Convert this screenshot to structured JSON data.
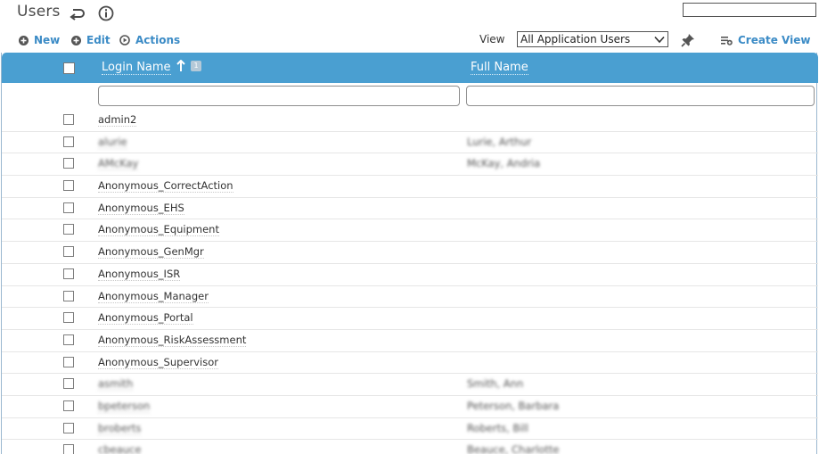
{
  "page": {
    "title": "Users"
  },
  "search": {
    "value": "",
    "placeholder": ""
  },
  "toolbar": {
    "new_label": "New",
    "edit_label": "Edit",
    "actions_label": "Actions",
    "view_label": "View",
    "view_selected": "All Application Users",
    "create_view_label": "Create View"
  },
  "grid": {
    "columns": {
      "login_name": "Login Name",
      "full_name": "Full Name"
    },
    "sort_order_badge": "1",
    "rows": [
      {
        "login": "admin2",
        "full_name": ""
      },
      {
        "login": "alurie",
        "full_name": "Lurie, Arthur"
      },
      {
        "login": "AMcKay",
        "full_name": "McKay, Andria"
      },
      {
        "login": "Anonymous_CorrectAction",
        "full_name": ""
      },
      {
        "login": "Anonymous_EHS",
        "full_name": ""
      },
      {
        "login": "Anonymous_Equipment",
        "full_name": ""
      },
      {
        "login": "Anonymous_GenMgr",
        "full_name": ""
      },
      {
        "login": "Anonymous_ISR",
        "full_name": ""
      },
      {
        "login": "Anonymous_Manager",
        "full_name": ""
      },
      {
        "login": "Anonymous_Portal",
        "full_name": ""
      },
      {
        "login": "Anonymous_RiskAssessment",
        "full_name": ""
      },
      {
        "login": "Anonymous_Supervisor",
        "full_name": ""
      },
      {
        "login": "asmith",
        "full_name": "Smith, Ann"
      },
      {
        "login": "bpeterson",
        "full_name": "Peterson, Barbara"
      },
      {
        "login": "broberts",
        "full_name": "Roberts, Bill"
      },
      {
        "login": "cbeauce",
        "full_name": "Beauce, Charlotte"
      }
    ]
  },
  "colors": {
    "accent": "#3b8bc6",
    "header_bg": "#4a9fd1"
  },
  "icons": {
    "undo": "undo-icon",
    "info": "info-icon",
    "new": "plus-circle-icon",
    "edit": "plus-circle-icon",
    "actions": "play-circle-icon",
    "pin": "pin-icon",
    "create_view": "list-add-icon",
    "sort": "sort-ascending-icon"
  }
}
